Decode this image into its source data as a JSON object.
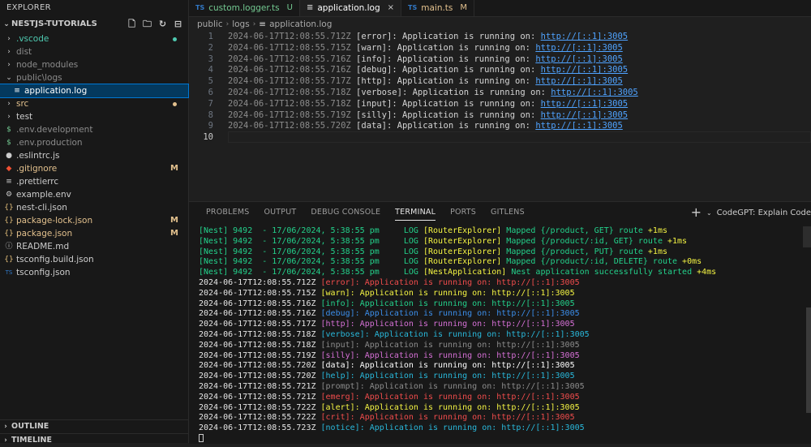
{
  "sidebar": {
    "title": "EXPLORER",
    "root": "NESTJS-TUTORIALS",
    "items": [
      {
        "label": ".vscode",
        "type": "folder",
        "color": "#4ec9b0",
        "dot": "#4ec9b0"
      },
      {
        "label": "dist",
        "type": "folder",
        "color": "#8c8c8c"
      },
      {
        "label": "node_modules",
        "type": "folder",
        "color": "#8c8c8c"
      },
      {
        "label": "public\\logs",
        "type": "folder-open",
        "color": "#8c8c8c"
      },
      {
        "label": "application.log",
        "type": "file",
        "color": "#ffffff",
        "selected": true
      },
      {
        "label": "src",
        "type": "folder",
        "color": "#e2c08d",
        "dot": "#e2c08d"
      },
      {
        "label": "test",
        "type": "folder",
        "color": "#cccccc"
      },
      {
        "label": ".env.development",
        "type": "file",
        "color": "#8c8c8c",
        "icon": "$"
      },
      {
        "label": ".env.production",
        "type": "file",
        "color": "#8c8c8c",
        "icon": "$"
      },
      {
        "label": ".eslintrc.js",
        "type": "file",
        "color": "#cccccc",
        "icon": "●"
      },
      {
        "label": ".gitignore",
        "type": "file",
        "color": "#e2c08d",
        "icon": "◆",
        "badge": "M"
      },
      {
        "label": ".prettierrc",
        "type": "file",
        "color": "#cccccc",
        "icon": "≡"
      },
      {
        "label": "example.env",
        "type": "file",
        "color": "#cccccc",
        "icon": "⚙"
      },
      {
        "label": "nest-cli.json",
        "type": "file",
        "color": "#cccccc",
        "icon": "{}"
      },
      {
        "label": "package-lock.json",
        "type": "file",
        "color": "#e2c08d",
        "icon": "{}",
        "badge": "M"
      },
      {
        "label": "package.json",
        "type": "file",
        "color": "#e2c08d",
        "icon": "{}",
        "badge": "M"
      },
      {
        "label": "README.md",
        "type": "file",
        "color": "#cccccc",
        "icon": "ⓘ"
      },
      {
        "label": "tsconfig.build.json",
        "type": "file",
        "color": "#cccccc",
        "icon": "{}"
      },
      {
        "label": "tsconfig.json",
        "type": "file",
        "color": "#cccccc",
        "icon": "TS"
      }
    ],
    "outline": "OUTLINE",
    "timeline": "TIMELINE"
  },
  "tabs": [
    {
      "label": "custom.logger.ts",
      "mod": "U",
      "modColor": "#73c991",
      "labelColor": "#73c991",
      "icon": "TS"
    },
    {
      "label": "application.log",
      "mod": "×",
      "modColor": "#cccccc",
      "labelColor": "#ffffff",
      "icon": "≡",
      "active": true
    },
    {
      "label": "main.ts",
      "mod": "M",
      "modColor": "#e2c08d",
      "labelColor": "#e2c08d",
      "icon": "TS"
    }
  ],
  "breadcrumb": [
    "public",
    "logs",
    "application.log"
  ],
  "editor": {
    "lines": [
      {
        "n": "1",
        "ts": "2024-06-17T12:08:55.712Z",
        "lvl": "[error]",
        "msg": ": Application is running on: ",
        "url": "http://[::1]:3005"
      },
      {
        "n": "2",
        "ts": "2024-06-17T12:08:55.715Z",
        "lvl": "[warn]",
        "msg": ": Application is running on: ",
        "url": "http://[::1]:3005"
      },
      {
        "n": "3",
        "ts": "2024-06-17T12:08:55.716Z",
        "lvl": "[info]",
        "msg": ": Application is running on: ",
        "url": "http://[::1]:3005"
      },
      {
        "n": "4",
        "ts": "2024-06-17T12:08:55.716Z",
        "lvl": "[debug]",
        "msg": ": Application is running on: ",
        "url": "http://[::1]:3005"
      },
      {
        "n": "5",
        "ts": "2024-06-17T12:08:55.717Z",
        "lvl": "[http]",
        "msg": ": Application is running on: ",
        "url": "http://[::1]:3005"
      },
      {
        "n": "6",
        "ts": "2024-06-17T12:08:55.718Z",
        "lvl": "[verbose]",
        "msg": ": Application is running on: ",
        "url": "http://[::1]:3005"
      },
      {
        "n": "7",
        "ts": "2024-06-17T12:08:55.718Z",
        "lvl": "[input]",
        "msg": ": Application is running on: ",
        "url": "http://[::1]:3005"
      },
      {
        "n": "8",
        "ts": "2024-06-17T12:08:55.719Z",
        "lvl": "[silly]",
        "msg": ": Application is running on: ",
        "url": "http://[::1]:3005"
      },
      {
        "n": "9",
        "ts": "2024-06-17T12:08:55.720Z",
        "lvl": "[data]",
        "msg": ": Application is running on: ",
        "url": "http://[::1]:3005"
      },
      {
        "n": "10",
        "ts": "",
        "lvl": "",
        "msg": "",
        "url": ""
      }
    ]
  },
  "panel": {
    "tabs": [
      "PROBLEMS",
      "OUTPUT",
      "DEBUG CONSOLE",
      "TERMINAL",
      "PORTS",
      "GITLENS"
    ],
    "active_tab": "TERMINAL",
    "right_label": "CodeGPT: Explain Code",
    "nest_lines": [
      {
        "prefix": "[Nest] 9492  - 17/06/2024, 5:38:55 pm     LOG ",
        "ctx": "[RouterExplorer]",
        "msg": " Mapped {/product, GET} route ",
        "time": "+1ms"
      },
      {
        "prefix": "[Nest] 9492  - 17/06/2024, 5:38:55 pm     LOG ",
        "ctx": "[RouterExplorer]",
        "msg": " Mapped {/product/:id, GET} route ",
        "time": "+1ms"
      },
      {
        "prefix": "[Nest] 9492  - 17/06/2024, 5:38:55 pm     LOG ",
        "ctx": "[RouterExplorer]",
        "msg": " Mapped {/product, PUT} route ",
        "time": "+1ms"
      },
      {
        "prefix": "[Nest] 9492  - 17/06/2024, 5:38:55 pm     LOG ",
        "ctx": "[RouterExplorer]",
        "msg": " Mapped {/product/:id, DELETE} route ",
        "time": "+0ms"
      },
      {
        "prefix": "[Nest] 9492  - 17/06/2024, 5:38:55 pm     LOG ",
        "ctx": "[NestApplication]",
        "msg": " Nest application successfully started ",
        "time": "+4ms"
      }
    ],
    "log_lines": [
      {
        "ts": "2024-06-17T12:08:55.712Z ",
        "lvl": "[error]",
        "msg": ": Application is running on: http://[::1]:3005",
        "color": "#f14c4c"
      },
      {
        "ts": "2024-06-17T12:08:55.715Z ",
        "lvl": "[warn]",
        "msg": ": Application is running on: http://[::1]:3005",
        "color": "#f5f543"
      },
      {
        "ts": "2024-06-17T12:08:55.716Z ",
        "lvl": "[info]",
        "msg": ": Application is running on: http://[::1]:3005",
        "color": "#23d18b"
      },
      {
        "ts": "2024-06-17T12:08:55.716Z ",
        "lvl": "[debug]",
        "msg": ": Application is running on: http://[::1]:3005",
        "color": "#3b8eea"
      },
      {
        "ts": "2024-06-17T12:08:55.717Z ",
        "lvl": "[http]",
        "msg": ": Application is running on: http://[::1]:3005",
        "color": "#d670d6"
      },
      {
        "ts": "2024-06-17T12:08:55.718Z ",
        "lvl": "[verbose]",
        "msg": ": Application is running on: http://[::1]:3005",
        "color": "#29b8db"
      },
      {
        "ts": "2024-06-17T12:08:55.718Z ",
        "lvl": "[input]",
        "msg": ": Application is running on: http://[::1]:3005",
        "color": "#8c8c8c"
      },
      {
        "ts": "2024-06-17T12:08:55.719Z ",
        "lvl": "[silly]",
        "msg": ": Application is running on: http://[::1]:3005",
        "color": "#d670d6"
      },
      {
        "ts": "2024-06-17T12:08:55.720Z ",
        "lvl": "[data]",
        "msg": ": Application is running on: http://[::1]:3005",
        "color": "#ffffff"
      },
      {
        "ts": "2024-06-17T12:08:55.720Z ",
        "lvl": "[help]",
        "msg": ": Application is running on: http://[::1]:3005",
        "color": "#29b8db"
      },
      {
        "ts": "2024-06-17T12:08:55.721Z ",
        "lvl": "[prompt]",
        "msg": ": Application is running on: http://[::1]:3005",
        "color": "#8c8c8c"
      },
      {
        "ts": "2024-06-17T12:08:55.721Z ",
        "lvl": "[emerg]",
        "msg": ": Application is running on: http://[::1]:3005",
        "color": "#f14c4c"
      },
      {
        "ts": "2024-06-17T12:08:55.722Z ",
        "lvl": "[alert]",
        "msg": ": Application is running on: http://[::1]:3005",
        "color": "#f5f543"
      },
      {
        "ts": "2024-06-17T12:08:55.722Z ",
        "lvl": "[crit]",
        "msg": ": Application is running on: http://[::1]:3005",
        "color": "#f14c4c"
      },
      {
        "ts": "2024-06-17T12:08:55.723Z ",
        "lvl": "[notice]",
        "msg": ": Application is running on: http://[::1]:3005",
        "color": "#29b8db"
      }
    ]
  }
}
